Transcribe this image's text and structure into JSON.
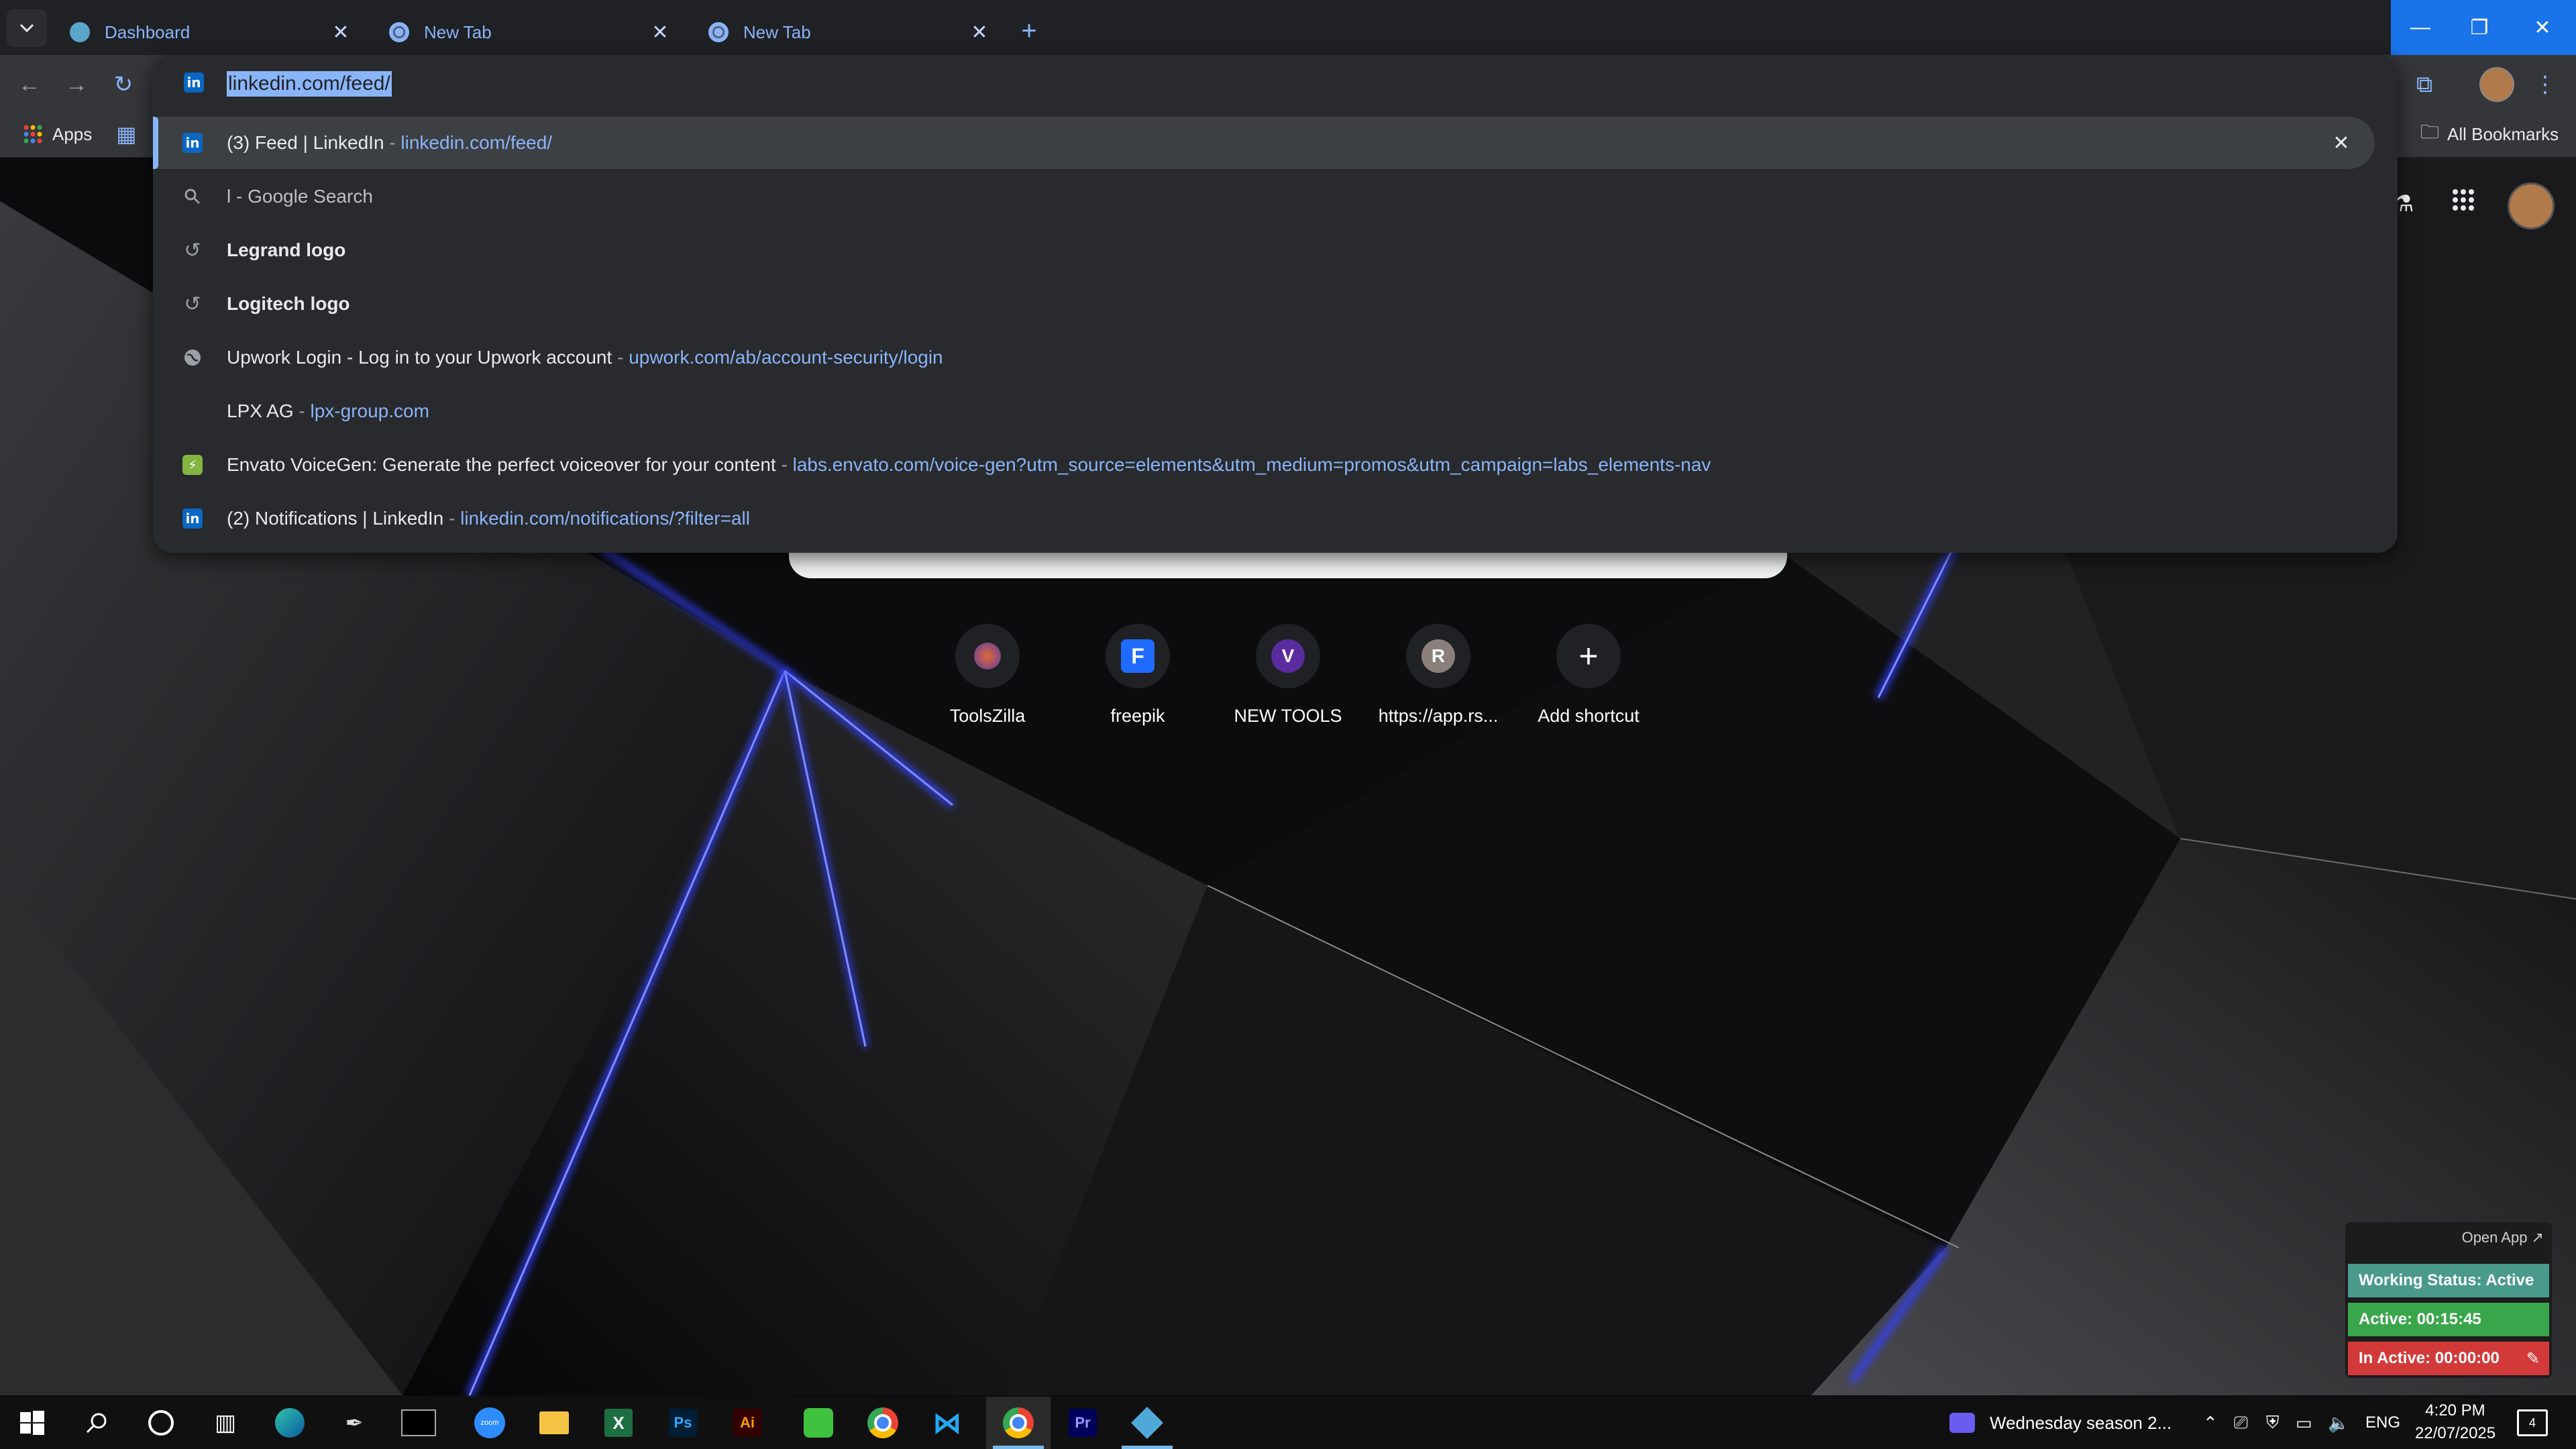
{
  "browser": {
    "tabs": [
      {
        "title": "Dashboard",
        "active": false
      },
      {
        "title": "New Tab",
        "active": false
      },
      {
        "title": "New Tab",
        "active": true
      }
    ],
    "bookmarks_bar": {
      "apps_label": "Apps",
      "all_bookmarks_label": "All Bookmarks"
    }
  },
  "omnibox": {
    "input_value": "linkedin.com/feed/",
    "suggestions": [
      {
        "icon": "linkedin-icon",
        "bold_title": "",
        "title": "(3) Feed | LinkedIn",
        "url": "linkedin.com/feed/",
        "selected": true
      },
      {
        "icon": "search-icon",
        "title": "l - Google Search",
        "url": ""
      },
      {
        "icon": "history-icon",
        "title": "Legrand logo",
        "url": ""
      },
      {
        "icon": "history-icon",
        "title": "Logitech logo",
        "url": ""
      },
      {
        "icon": "globe-icon",
        "title": "Upwork Login - Log in to your Upwork account",
        "url": "upwork.com/ab/account-security/login"
      },
      {
        "icon": "blank-icon",
        "title": "LPX AG",
        "url": "lpx-group.com"
      },
      {
        "icon": "envato-icon",
        "title": "Envato VoiceGen: Generate the perfect voiceover for your content",
        "url": "labs.envato.com/voice-gen?utm_source=elements&utm_medium=promos&utm_campaign=labs_elements-nav"
      },
      {
        "icon": "linkedin-icon",
        "title": "(2) Notifications | LinkedIn",
        "url": "linkedin.com/notifications/?filter=all"
      }
    ]
  },
  "new_tab_page": {
    "shortcuts": [
      {
        "label": "ToolsZilla",
        "glyph": ""
      },
      {
        "label": "freepik",
        "glyph": "F"
      },
      {
        "label": "NEW TOOLS",
        "glyph": "V"
      },
      {
        "label": "https://app.rs...",
        "glyph": "R"
      },
      {
        "label": "Add shortcut",
        "glyph": "+"
      }
    ]
  },
  "tracker_widget": {
    "open_app": "Open App ↗",
    "working_status": "Working Status: Active",
    "active_time": "Active: 00:15:45",
    "inactive_time": "In Active: 00:00:00",
    "colors": {
      "working": "#4a9a8c",
      "active": "#3aa64c",
      "inactive": "#d23a3a"
    }
  },
  "taskbar": {
    "media_title": "Wednesday season 2...",
    "language": "ENG",
    "time": "4:20 PM",
    "date": "22/07/2025",
    "notification_count": "4"
  },
  "colors": {
    "accent": "#8ab4f8",
    "wallpaper_glow": "#2a3bff"
  }
}
